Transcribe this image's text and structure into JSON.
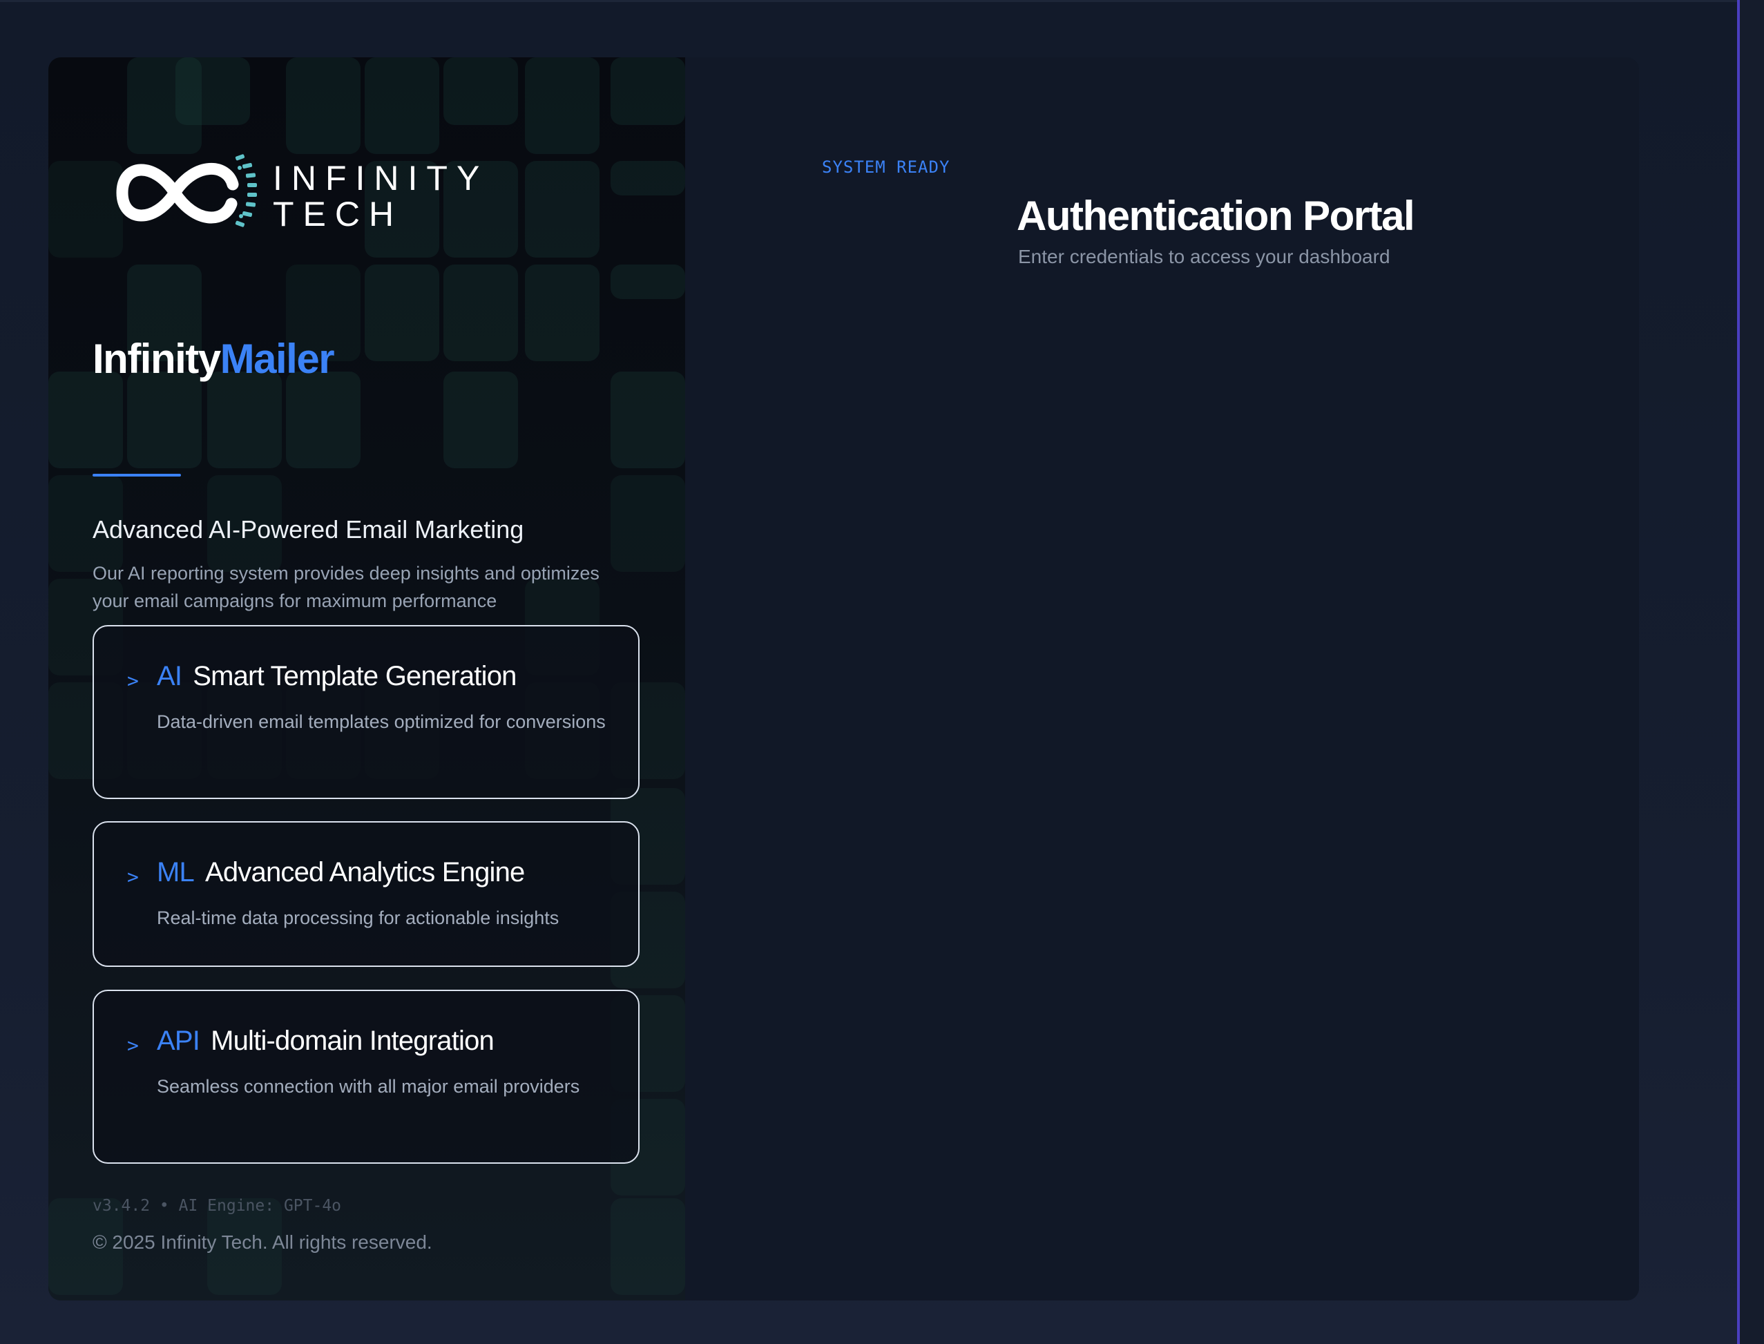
{
  "brand": {
    "logo": {
      "line1": "INFINITY",
      "line2": "TECH"
    },
    "product_name_part1": "Infinity",
    "product_name_part2": "Mailer"
  },
  "intro": {
    "tagline": "Advanced AI-Powered Email Marketing",
    "description": "Our AI reporting system provides deep insights and optimizes your email campaigns for maximum performance"
  },
  "features": [
    {
      "arrow": ">",
      "tag": "AI",
      "title": "Smart Template Generation",
      "description": "Data-driven email templates optimized for conversions"
    },
    {
      "arrow": ">",
      "tag": "ML",
      "title": "Advanced Analytics Engine",
      "description": "Real-time data processing for actionable insights"
    },
    {
      "arrow": ">",
      "tag": "API",
      "title": "Multi-domain Integration",
      "description": "Seamless connection with all major email providers"
    }
  ],
  "footer": {
    "version": "v3.4.2 • AI Engine: GPT-4o",
    "copyright": "© 2025 Infinity Tech. All rights reserved."
  },
  "auth": {
    "status": "SYSTEM READY",
    "title": "Authentication Portal",
    "subtitle": "Enter credentials to access your dashboard"
  },
  "colors": {
    "accent": "#3b82f6",
    "logo_teal": "#5fc3c9",
    "background": "#111827"
  }
}
